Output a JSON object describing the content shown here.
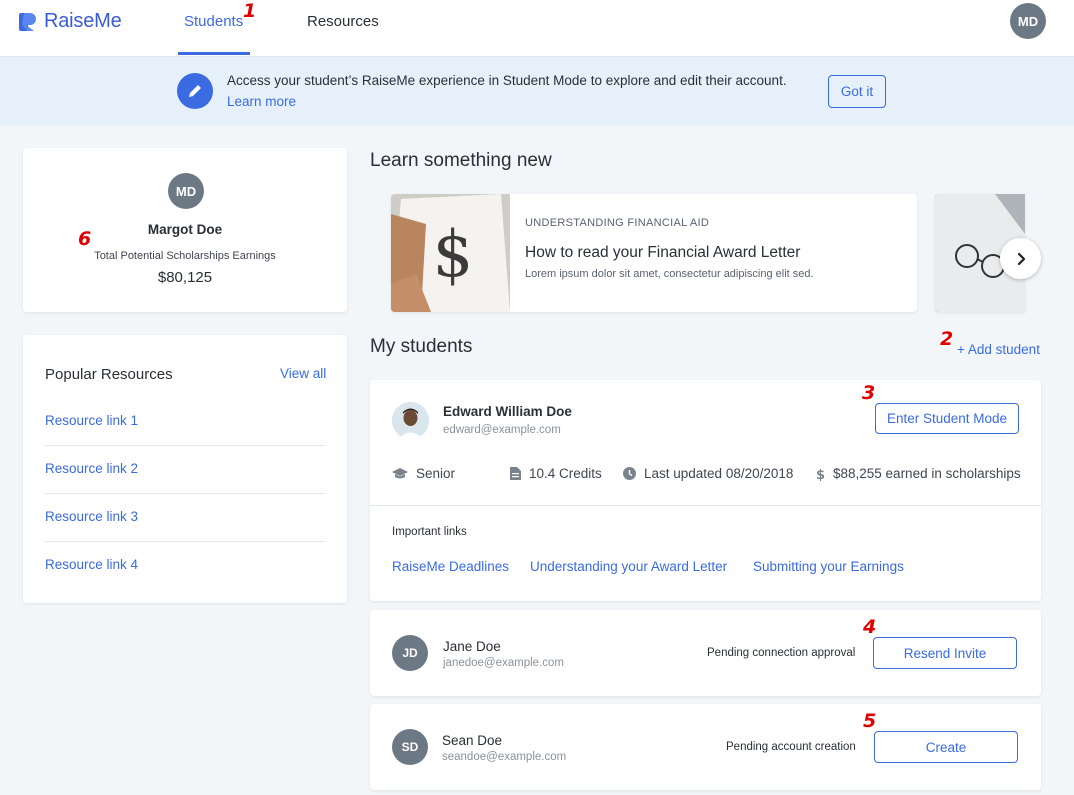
{
  "app": {
    "logo_text": "RaiseMe",
    "brand_color": "#3a6be0"
  },
  "nav": {
    "tabs": [
      {
        "label": "Students",
        "active": true
      },
      {
        "label": "Resources",
        "active": false
      }
    ],
    "user_initials": "MD"
  },
  "banner": {
    "icon": "pencil-icon",
    "message": "Access your student’s RaiseMe experience in Student Mode to explore and edit their account.",
    "link": "Learn more",
    "button": "Got it"
  },
  "profile": {
    "initials": "MD",
    "name": "Margot Doe",
    "subtitle": "Total Potential Scholarships Earnings",
    "amount": "$80,125"
  },
  "resources": {
    "title": "Popular Resources",
    "view_all": "View all",
    "links": [
      "Resource link 1",
      "Resource link 2",
      "Resource link 3",
      "Resource link 4"
    ]
  },
  "learn": {
    "title": "Learn something new",
    "card": {
      "kicker": "UNDERSTANDING FINANCIAL AID",
      "title": "How to read your Financial Award Letter",
      "description": "Lorem ipsum dolor sit amet, consectetur adipiscing elit sed."
    }
  },
  "students": {
    "title": "My students",
    "add_label": "+ Add student",
    "main": {
      "name": "Edward William Doe",
      "email": "edward@example.com",
      "button": "Enter Student Mode",
      "stats": [
        {
          "icon": "graduation-cap-icon",
          "label": "Senior"
        },
        {
          "icon": "document-icon",
          "label": "10.4 Credits"
        },
        {
          "icon": "clock-icon",
          "label": "Last updated 08/20/2018"
        },
        {
          "icon": "dollar-icon",
          "label": "$88,255 earned in scholarships"
        }
      ],
      "important_links_title": "Important links",
      "important_links": [
        "RaiseMe Deadlines",
        "Understanding your Award Letter",
        "Submitting your Earnings"
      ]
    },
    "others": [
      {
        "initials": "JD",
        "name": "Jane Doe",
        "email": "janedoe@example.com",
        "status": "Pending connection approval",
        "button": "Resend Invite"
      },
      {
        "initials": "SD",
        "name": "Sean Doe",
        "email": "seandoe@example.com",
        "status": "Pending account creation",
        "button": "Create"
      }
    ]
  },
  "annotations": [
    "1",
    "2",
    "3",
    "4",
    "5",
    "6"
  ]
}
